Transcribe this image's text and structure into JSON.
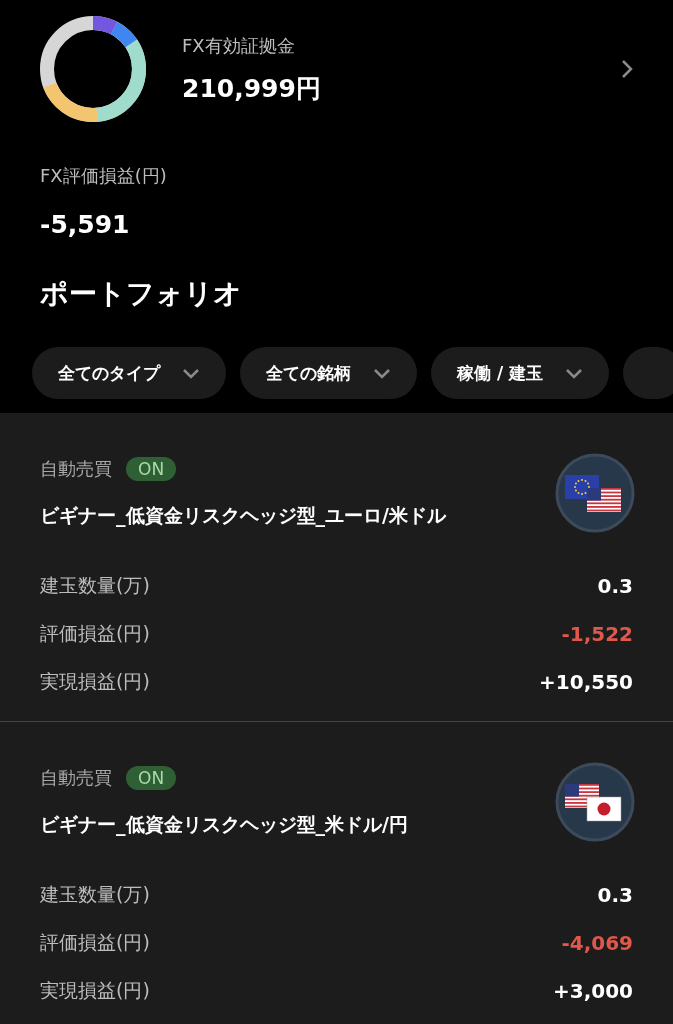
{
  "summary": {
    "margin_label": "FX有効証拠金",
    "margin_value": "210,999円",
    "pl_label": "FX評価損益(円)",
    "pl_value": "-5,591"
  },
  "portfolio_title": "ポートフォリオ",
  "filters": [
    {
      "label": "全てのタイプ"
    },
    {
      "label": "全ての銘柄"
    },
    {
      "label": "稼働 / 建玉"
    }
  ],
  "strategies": [
    {
      "auto_label": "自動売買",
      "auto_on": true,
      "auto_badge": "ON",
      "name": "ビギナー_低資金リスクヘッジ型_ユーロ/米ドル",
      "flags": [
        {
          "kind": "eu"
        },
        {
          "kind": "us"
        }
      ],
      "rows": [
        {
          "label": "建玉数量(万)",
          "value": "0.3",
          "kind": "plain"
        },
        {
          "label": "評価損益(円)",
          "value": "-1,522",
          "kind": "loss"
        },
        {
          "label": "実現損益(円)",
          "value": "+10,550",
          "kind": "plain"
        }
      ]
    },
    {
      "auto_label": "自動売買",
      "auto_on": true,
      "auto_badge": "ON",
      "name": "ビギナー_低資金リスクヘッジ型_米ドル/円",
      "flags": [
        {
          "kind": "us"
        },
        {
          "kind": "jp"
        }
      ],
      "rows": [
        {
          "label": "建玉数量(万)",
          "value": "0.3",
          "kind": "plain"
        },
        {
          "label": "評価損益(円)",
          "value": "-4,069",
          "kind": "loss"
        },
        {
          "label": "実現損益(円)",
          "value": "+3,000",
          "kind": "plain"
        }
      ]
    }
  ]
}
